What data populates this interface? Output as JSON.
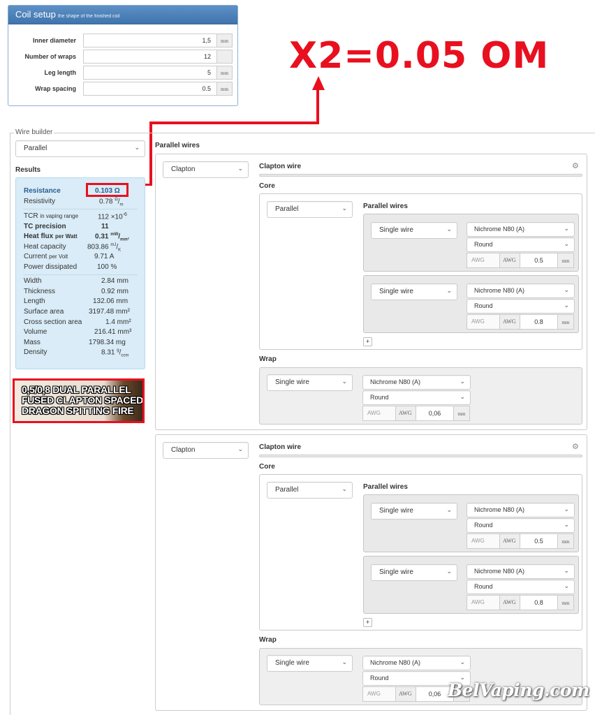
{
  "coil_setup": {
    "title": "Coil setup",
    "subtitle": "the shape of the finished coil",
    "rows": [
      {
        "label": "Inner diameter",
        "value": "1,5",
        "unit": "mm"
      },
      {
        "label": "Number of wraps",
        "value": "12",
        "unit": ""
      },
      {
        "label": "Leg length",
        "value": "5",
        "unit": "mm"
      },
      {
        "label": "Wrap spacing",
        "value": "0.5",
        "unit": "mm"
      }
    ]
  },
  "annotation": {
    "text": "X2=0.05 OM",
    "color": "#e8101f"
  },
  "wire_builder": {
    "legend": "Wire builder",
    "type_select": "Parallel",
    "results_title": "Results",
    "parallel_title": "Parallel wires"
  },
  "results": {
    "resistance": {
      "label": "Resistance",
      "value": "0.103 Ω"
    },
    "resistivity": {
      "label": "Resistivity",
      "value": "0.78",
      "unit_sup": "Ω",
      "unit_sub": "m"
    },
    "tcr": {
      "label": "TCR",
      "label_small": "in vaping range",
      "value": "112 ×10",
      "sup": "-6"
    },
    "tc_precision": {
      "label": "TC precision",
      "value": "11"
    },
    "heat_flux": {
      "label": "Heat flux",
      "label_small": "per Watt",
      "value": "0.31",
      "unit_sup": "mW",
      "unit_sub": "mm²"
    },
    "heat_capacity": {
      "label": "Heat capacity",
      "value": "803.86",
      "unit_sup": "mJ",
      "unit_sub": "K"
    },
    "current": {
      "label": "Current",
      "label_small": "per Volt",
      "value": "9.71 A"
    },
    "power": {
      "label": "Power dissipated",
      "value": "100 %"
    },
    "width": {
      "label": "Width",
      "value": "2.84 mm"
    },
    "thickness": {
      "label": "Thickness",
      "value": "0.92 mm"
    },
    "length": {
      "label": "Length",
      "value": "132.06 mm"
    },
    "surface": {
      "label": "Surface area",
      "value": "3197.48 mm²"
    },
    "cross": {
      "label": "Cross section area",
      "value": "1.4 mm²"
    },
    "volume": {
      "label": "Volume",
      "value": "216.41 mm³"
    },
    "mass": {
      "label": "Mass",
      "value": "1798.34 mg"
    },
    "density": {
      "label": "Density",
      "value": "8.31",
      "unit_sup": "g",
      "unit_sub": "ccm"
    }
  },
  "thumbnail": {
    "text": "0,5/0,8 DUAL PARALLEL FUSED CLAPTON SPACED DRAGON SPITTING FIRE"
  },
  "wires": [
    {
      "type": "Clapton",
      "title": "Clapton wire",
      "core_label": "Core",
      "core_type": "Parallel",
      "core_title": "Parallel wires",
      "strands": [
        {
          "type": "Single wire",
          "material": "Nichrome N80 (A)",
          "shape": "Round",
          "awg": "AWG",
          "awg_btn": "AWG",
          "value": "0.5",
          "unit": "mm"
        },
        {
          "type": "Single wire",
          "material": "Nichrome N80 (A)",
          "shape": "Round",
          "awg": "AWG",
          "awg_btn": "AWG",
          "value": "0.8",
          "unit": "mm"
        }
      ],
      "add": "+",
      "wrap_label": "Wrap",
      "wrap": {
        "type": "Single wire",
        "material": "Nichrome N80 (A)",
        "shape": "Round",
        "awg": "AWG",
        "awg_btn": "AWG",
        "value": "0,06",
        "unit": "mm"
      }
    },
    {
      "type": "Clapton",
      "title": "Clapton wire",
      "core_label": "Core",
      "core_type": "Parallel",
      "core_title": "Parallel wires",
      "strands": [
        {
          "type": "Single wire",
          "material": "Nichrome N80 (A)",
          "shape": "Round",
          "awg": "AWG",
          "awg_btn": "AWG",
          "value": "0.5",
          "unit": "mm"
        },
        {
          "type": "Single wire",
          "material": "Nichrome N80 (A)",
          "shape": "Round",
          "awg": "AWG",
          "awg_btn": "AWG",
          "value": "0.8",
          "unit": "mm"
        }
      ],
      "add": "+",
      "wrap_label": "Wrap",
      "wrap": {
        "type": "Single wire",
        "material": "Nichrome N80 (A)",
        "shape": "Round",
        "awg": "AWG",
        "awg_btn": "AWG",
        "value": "0,06",
        "unit": "mm"
      }
    }
  ],
  "watermark": "BelVaping.com"
}
